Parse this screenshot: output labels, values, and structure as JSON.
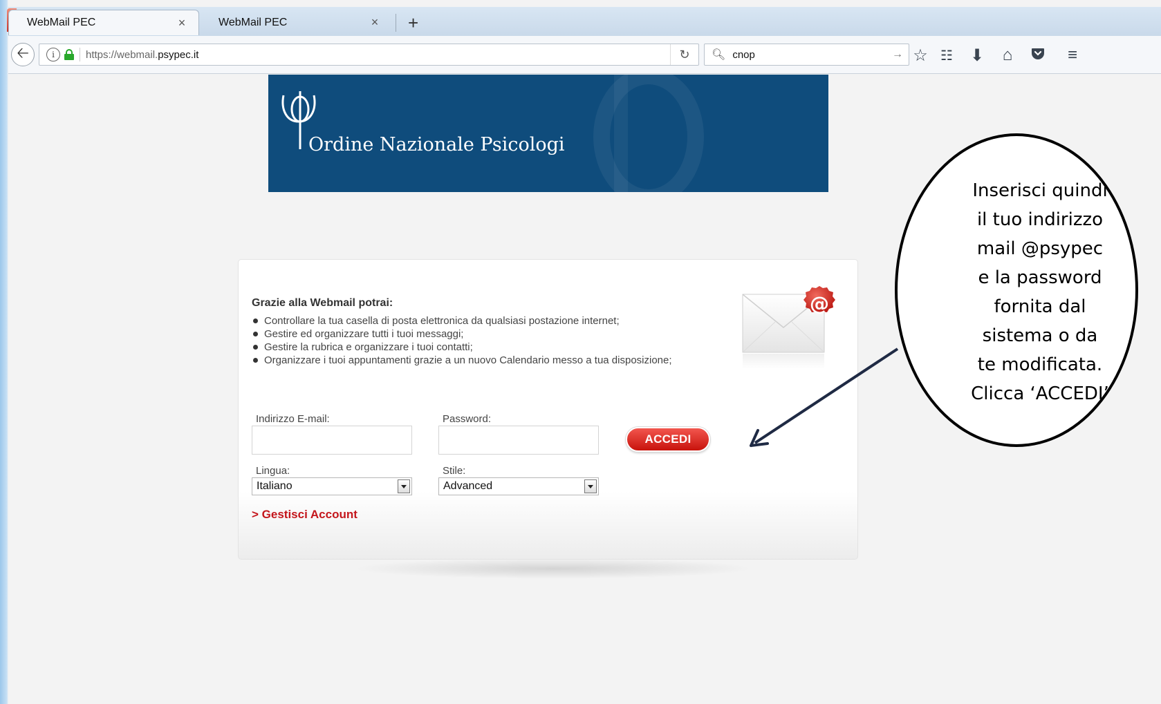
{
  "browser": {
    "tabs": [
      {
        "label": "WebMail PEC",
        "close": "×",
        "active": true
      },
      {
        "label": "WebMail PEC",
        "close": "×",
        "active": false
      }
    ],
    "new_tab": "+",
    "url_dim": "https://webmail.",
    "url_host": "psypec.it",
    "search_value": "cnop",
    "icons": [
      "back-arrow-icon",
      "info-icon",
      "lock-icon",
      "reload-icon",
      "search-icon",
      "arrow-right-icon",
      "bookmark-star-icon",
      "reading-list-icon",
      "download-icon",
      "home-icon",
      "pocket-icon",
      "menu-icon"
    ]
  },
  "banner": {
    "org_name": "Ordine Nazionale Psicologi"
  },
  "login": {
    "features_title": "Grazie alla Webmail potrai:",
    "features": [
      "Controllare la tua casella di posta elettronica da qualsiasi postazione internet;",
      "Gestire ed organizzare tutti i tuoi messaggi;",
      "Gestire la rubrica e organizzare i tuoi contatti;",
      "Organizzare i tuoi appuntamenti grazie a un nuovo Calendario messo a tua disposizione;"
    ],
    "email_label": "Indirizzo E-mail:",
    "email_value": "",
    "password_label": "Password:",
    "password_value": "",
    "submit_label": "ACCEDI",
    "language_label": "Lingua:",
    "language_value": "Italiano",
    "style_label": "Stile:",
    "style_value": "Advanced",
    "manage_account": "> Gestisci Account",
    "accent_color": "#c4161c",
    "banner_color": "#0f4c7c"
  },
  "callout": {
    "text": "Inserisci quindi\nil tuo indirizzo\nmail @psypec\ne la password\nfornita dal\nsistema o da\nte modificata.\nClicca ‘ACCEDI’"
  }
}
